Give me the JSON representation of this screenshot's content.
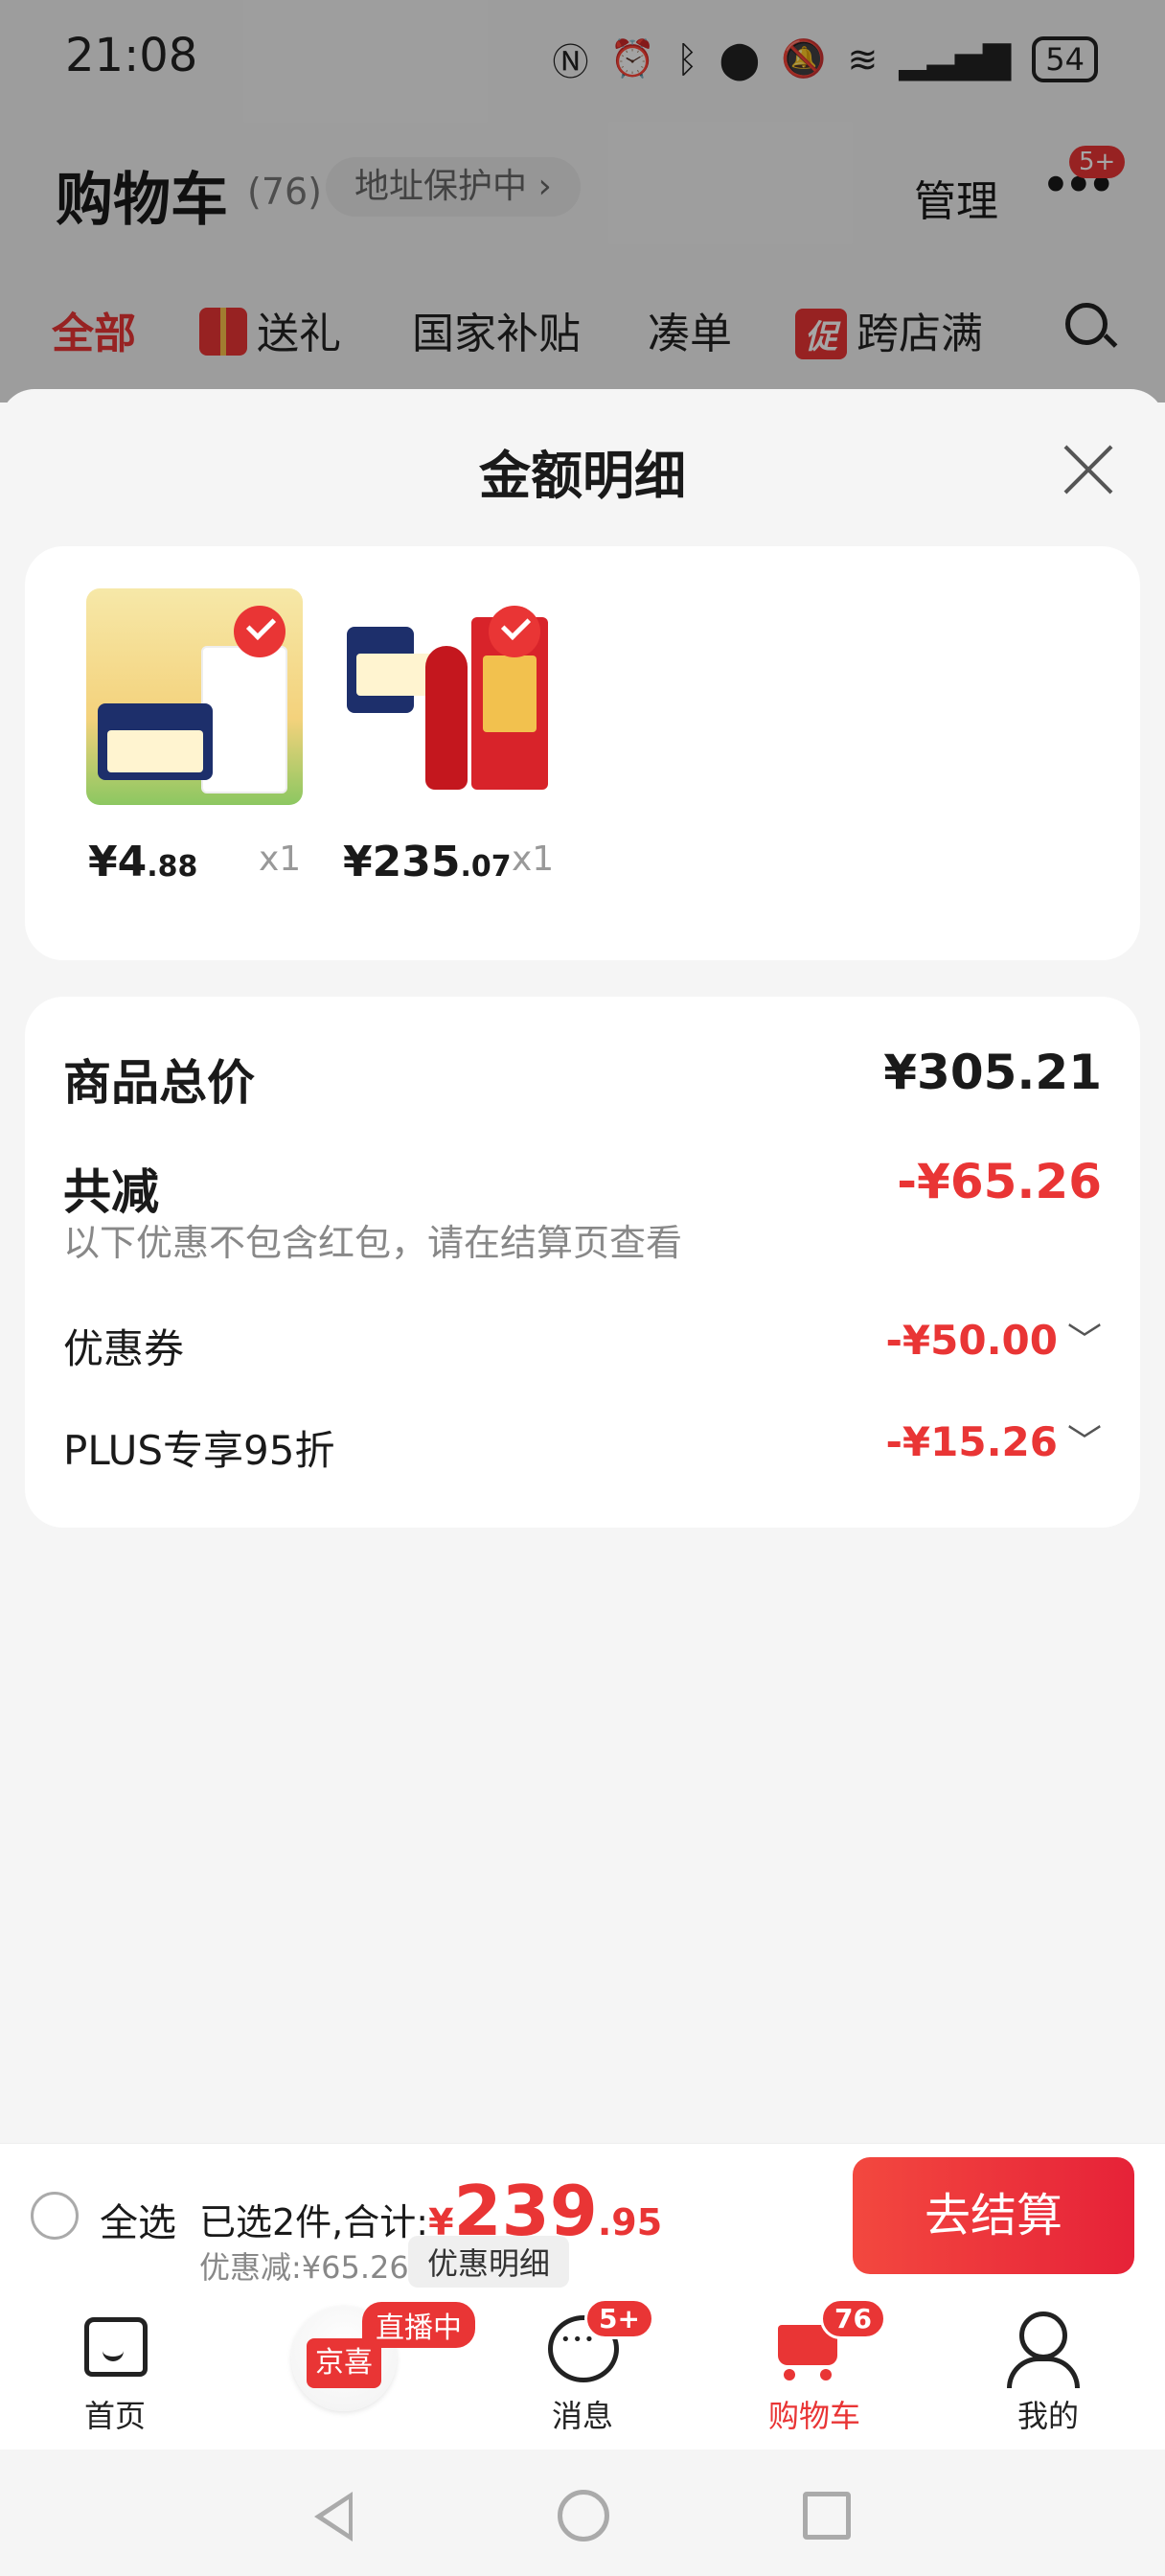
{
  "status_bar": {
    "time": "21:08",
    "battery": "54"
  },
  "header": {
    "title": "购物车",
    "count": "(76)",
    "address": "地址保护中 ›",
    "manage": "管理",
    "more_badge": "5+"
  },
  "tabs": [
    {
      "label": "全部"
    },
    {
      "label": "送礼"
    },
    {
      "label": "国家补贴"
    },
    {
      "label": "凑单"
    },
    {
      "label": "跨店满",
      "promo": "促"
    }
  ],
  "sheet": {
    "title": "金额明细",
    "products": [
      {
        "price_int": "¥4",
        "price_dec": ".88",
        "qty": "x1"
      },
      {
        "price_int": "¥235",
        "price_dec": ".07",
        "qty": "x1"
      }
    ],
    "summary": {
      "total_label": "商品总价",
      "total_value": "¥305.21",
      "reduce_label": "共减",
      "reduce_value": "-¥65.26",
      "note": "以下优惠不包含红包，请在结算页查看",
      "items": [
        {
          "label": "优惠券",
          "value": "-¥50.00"
        },
        {
          "label": "PLUS专享95折",
          "value": "-¥15.26"
        }
      ]
    }
  },
  "checkout": {
    "select_all": "全选",
    "selected_text": "已选2件,合计:",
    "currency": "¥",
    "total_int": "239",
    "total_dec": ".95",
    "discount_text": "优惠减:¥65.26",
    "discount_detail": "优惠明细",
    "button": "去结算"
  },
  "tabbar": {
    "home": "首页",
    "jx_label": "京喜",
    "live_badge": "直播中",
    "messages": "消息",
    "messages_badge": "5+",
    "cart": "购物车",
    "cart_badge": "76",
    "me": "我的"
  },
  "colors": {
    "accent": "#e93535"
  }
}
